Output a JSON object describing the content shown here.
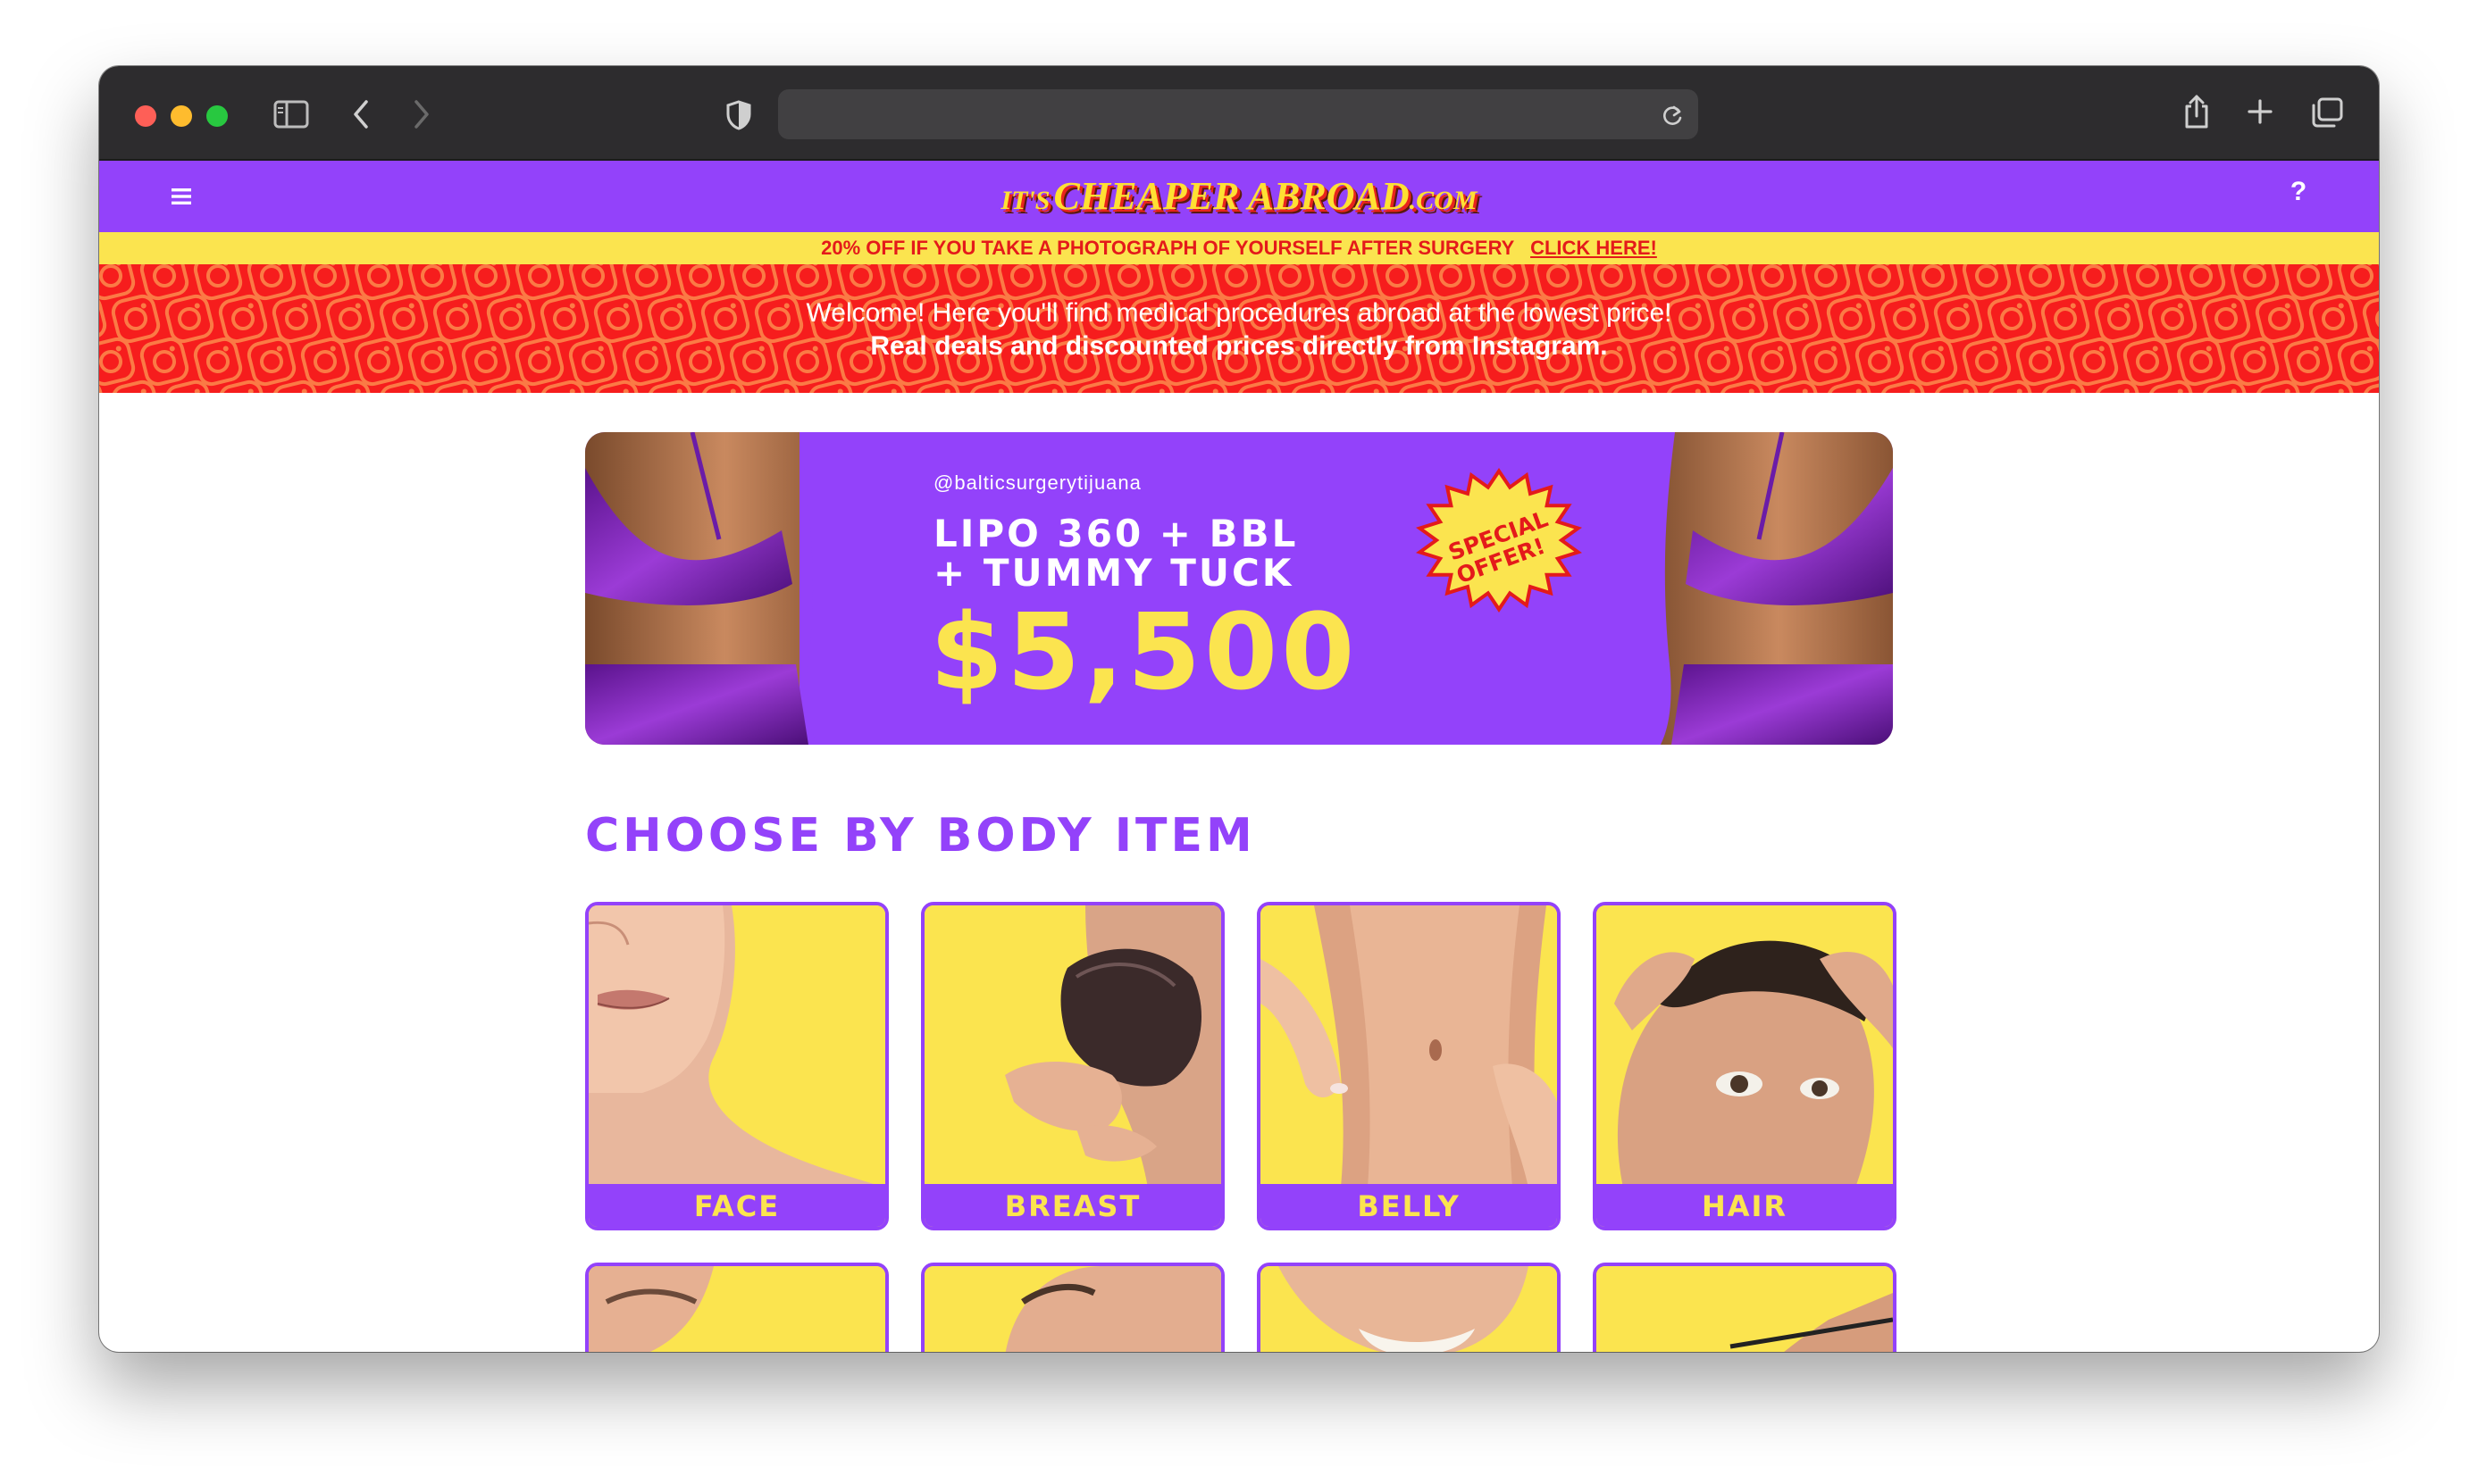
{
  "browser": {
    "address": "",
    "icons": [
      "sidebar-toggle-icon",
      "back-icon",
      "forward-icon",
      "shield-icon",
      "reload-icon",
      "share-icon",
      "new-tab-icon",
      "tab-overview-icon"
    ]
  },
  "header": {
    "menu_icon": "hamburger-icon",
    "logo_prefix": "IT'S",
    "logo_main": "CHEAPER ABROAD",
    "logo_suffix": ".COM",
    "help_label": "?"
  },
  "promo": {
    "text": "20% OFF IF YOU TAKE A PHOTOGRAPH OF YOURSELF AFTER SURGERY",
    "link": "CLICK HERE!"
  },
  "welcome": {
    "line1": "Welcome! Here you'll find medical procedures abroad at the lowest price!",
    "line2": "Real deals and discounted prices directly from Instagram."
  },
  "banner": {
    "handle": "@balticsurgerytijuana",
    "title_line1": "LIPO 360 + BBL",
    "title_line2": "+ TUMMY TUCK",
    "price": "$5,500",
    "badge_line1": "SPECIAL",
    "badge_line2": "OFFER!"
  },
  "section": {
    "title": "CHOOSE BY BODY ITEM"
  },
  "cards": [
    {
      "label": "FACE"
    },
    {
      "label": "BREAST"
    },
    {
      "label": "BELLY"
    },
    {
      "label": "HAIR"
    },
    {
      "label": ""
    },
    {
      "label": ""
    },
    {
      "label": ""
    },
    {
      "label": ""
    }
  ],
  "colors": {
    "brand_purple": "#9342fa",
    "brand_yellow": "#fbe44f",
    "brand_red": "#f61d1d"
  }
}
